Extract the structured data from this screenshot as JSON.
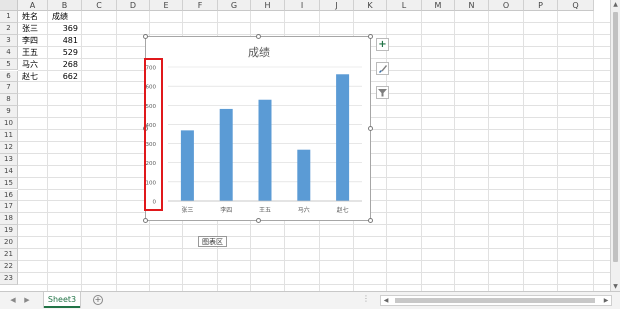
{
  "columns": [
    "A",
    "B",
    "C",
    "D",
    "E",
    "F",
    "G",
    "H",
    "I",
    "J",
    "K",
    "L",
    "M",
    "N",
    "O",
    "P",
    "Q"
  ],
  "rows": [
    "1",
    "2",
    "3",
    "4",
    "5",
    "6",
    "7",
    "8",
    "9",
    "10",
    "11",
    "12",
    "13",
    "14",
    "15",
    "16",
    "17",
    "18",
    "19",
    "20",
    "21",
    "22",
    "23"
  ],
  "cells": {
    "header": {
      "name": "姓名",
      "score": "成绩"
    },
    "data": [
      {
        "name": "张三",
        "score": "369"
      },
      {
        "name": "李四",
        "score": "481"
      },
      {
        "name": "王五",
        "score": "529"
      },
      {
        "name": "马六",
        "score": "268"
      },
      {
        "name": "赵七",
        "score": "662"
      }
    ]
  },
  "chart_data": {
    "type": "bar",
    "title": "成绩",
    "categories": [
      "张三",
      "李四",
      "王五",
      "马六",
      "赵七"
    ],
    "values": [
      369,
      481,
      529,
      268,
      662
    ],
    "ylim": [
      0,
      700
    ],
    "yticks": [
      "700",
      "600",
      "500",
      "400",
      "300",
      "200",
      "100",
      "0"
    ],
    "grid": true,
    "bar_color": "#5b9bd5"
  },
  "chart_tools": {
    "add_icon": "+",
    "style_icon": "brush-icon",
    "filter_icon": "funnel-icon"
  },
  "tooltip": "图表区",
  "sheet_tab": "Sheet3",
  "add_sheet": "+",
  "colors": {
    "highlight": "#e0181b",
    "accent": "#217346"
  }
}
